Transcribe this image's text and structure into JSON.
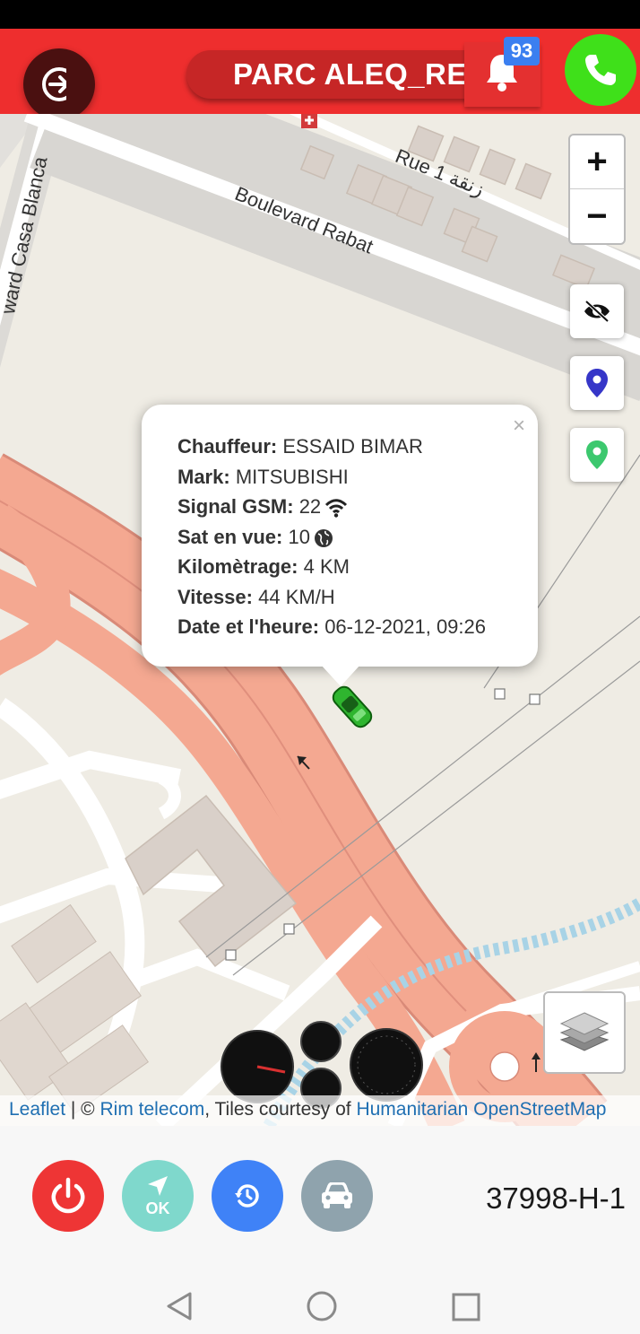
{
  "header": {
    "title": "PARC ALEQ_REDI",
    "notification_count": "93",
    "colors": {
      "bar": "#ee2e2e",
      "logout": "#4a1010",
      "call": "#3fe01a",
      "badge": "#3b7ff0"
    },
    "icons": [
      "logout-icon",
      "bell-icon",
      "phone-icon"
    ]
  },
  "map": {
    "street_labels": {
      "boulevard_rabat": "Boulevard Rabat",
      "rue_1": "Rue 1 زنقة",
      "casa_blanca": "ward Casa Blanca"
    },
    "zoom": {
      "in": "+",
      "out": "−"
    },
    "popup": {
      "close": "×",
      "rows": [
        {
          "label": "Chauffeur:",
          "value": "ESSAID BIMAR"
        },
        {
          "label": "Mark:",
          "value": "MITSUBISHI"
        },
        {
          "label": "Signal GSM:",
          "value": "22",
          "icon": "wifi-icon"
        },
        {
          "label": "Sat en vue:",
          "value": "10",
          "icon": "globe-icon"
        },
        {
          "label": "Kilomètrage:",
          "value": "4 KM"
        },
        {
          "label": "Vitesse:",
          "value": "44 KM/H"
        },
        {
          "label": "Date et l'heure:",
          "value": "06-12-2021, 09:26"
        }
      ]
    },
    "attribution": {
      "leaflet": "Leaflet",
      "sep1": " | © ",
      "rim": "Rim telecom",
      "mid": ", Tiles courtesy of ",
      "hot": "Humanitarian OpenStreetMap"
    },
    "side_icons": [
      "eye-slash-icon",
      "blue-marker-icon",
      "green-marker-icon",
      "layers-icon"
    ],
    "road_color": "#f4a891"
  },
  "bottom": {
    "ok_label": "OK",
    "plate": "37998-H-1",
    "buttons": [
      {
        "name": "power-button",
        "color": "#ee3535"
      },
      {
        "name": "navigate-ok-button",
        "color": "#7fd8cc"
      },
      {
        "name": "history-button",
        "color": "#3f82f7"
      },
      {
        "name": "vehicle-button",
        "color": "#8fa3ad"
      }
    ]
  }
}
